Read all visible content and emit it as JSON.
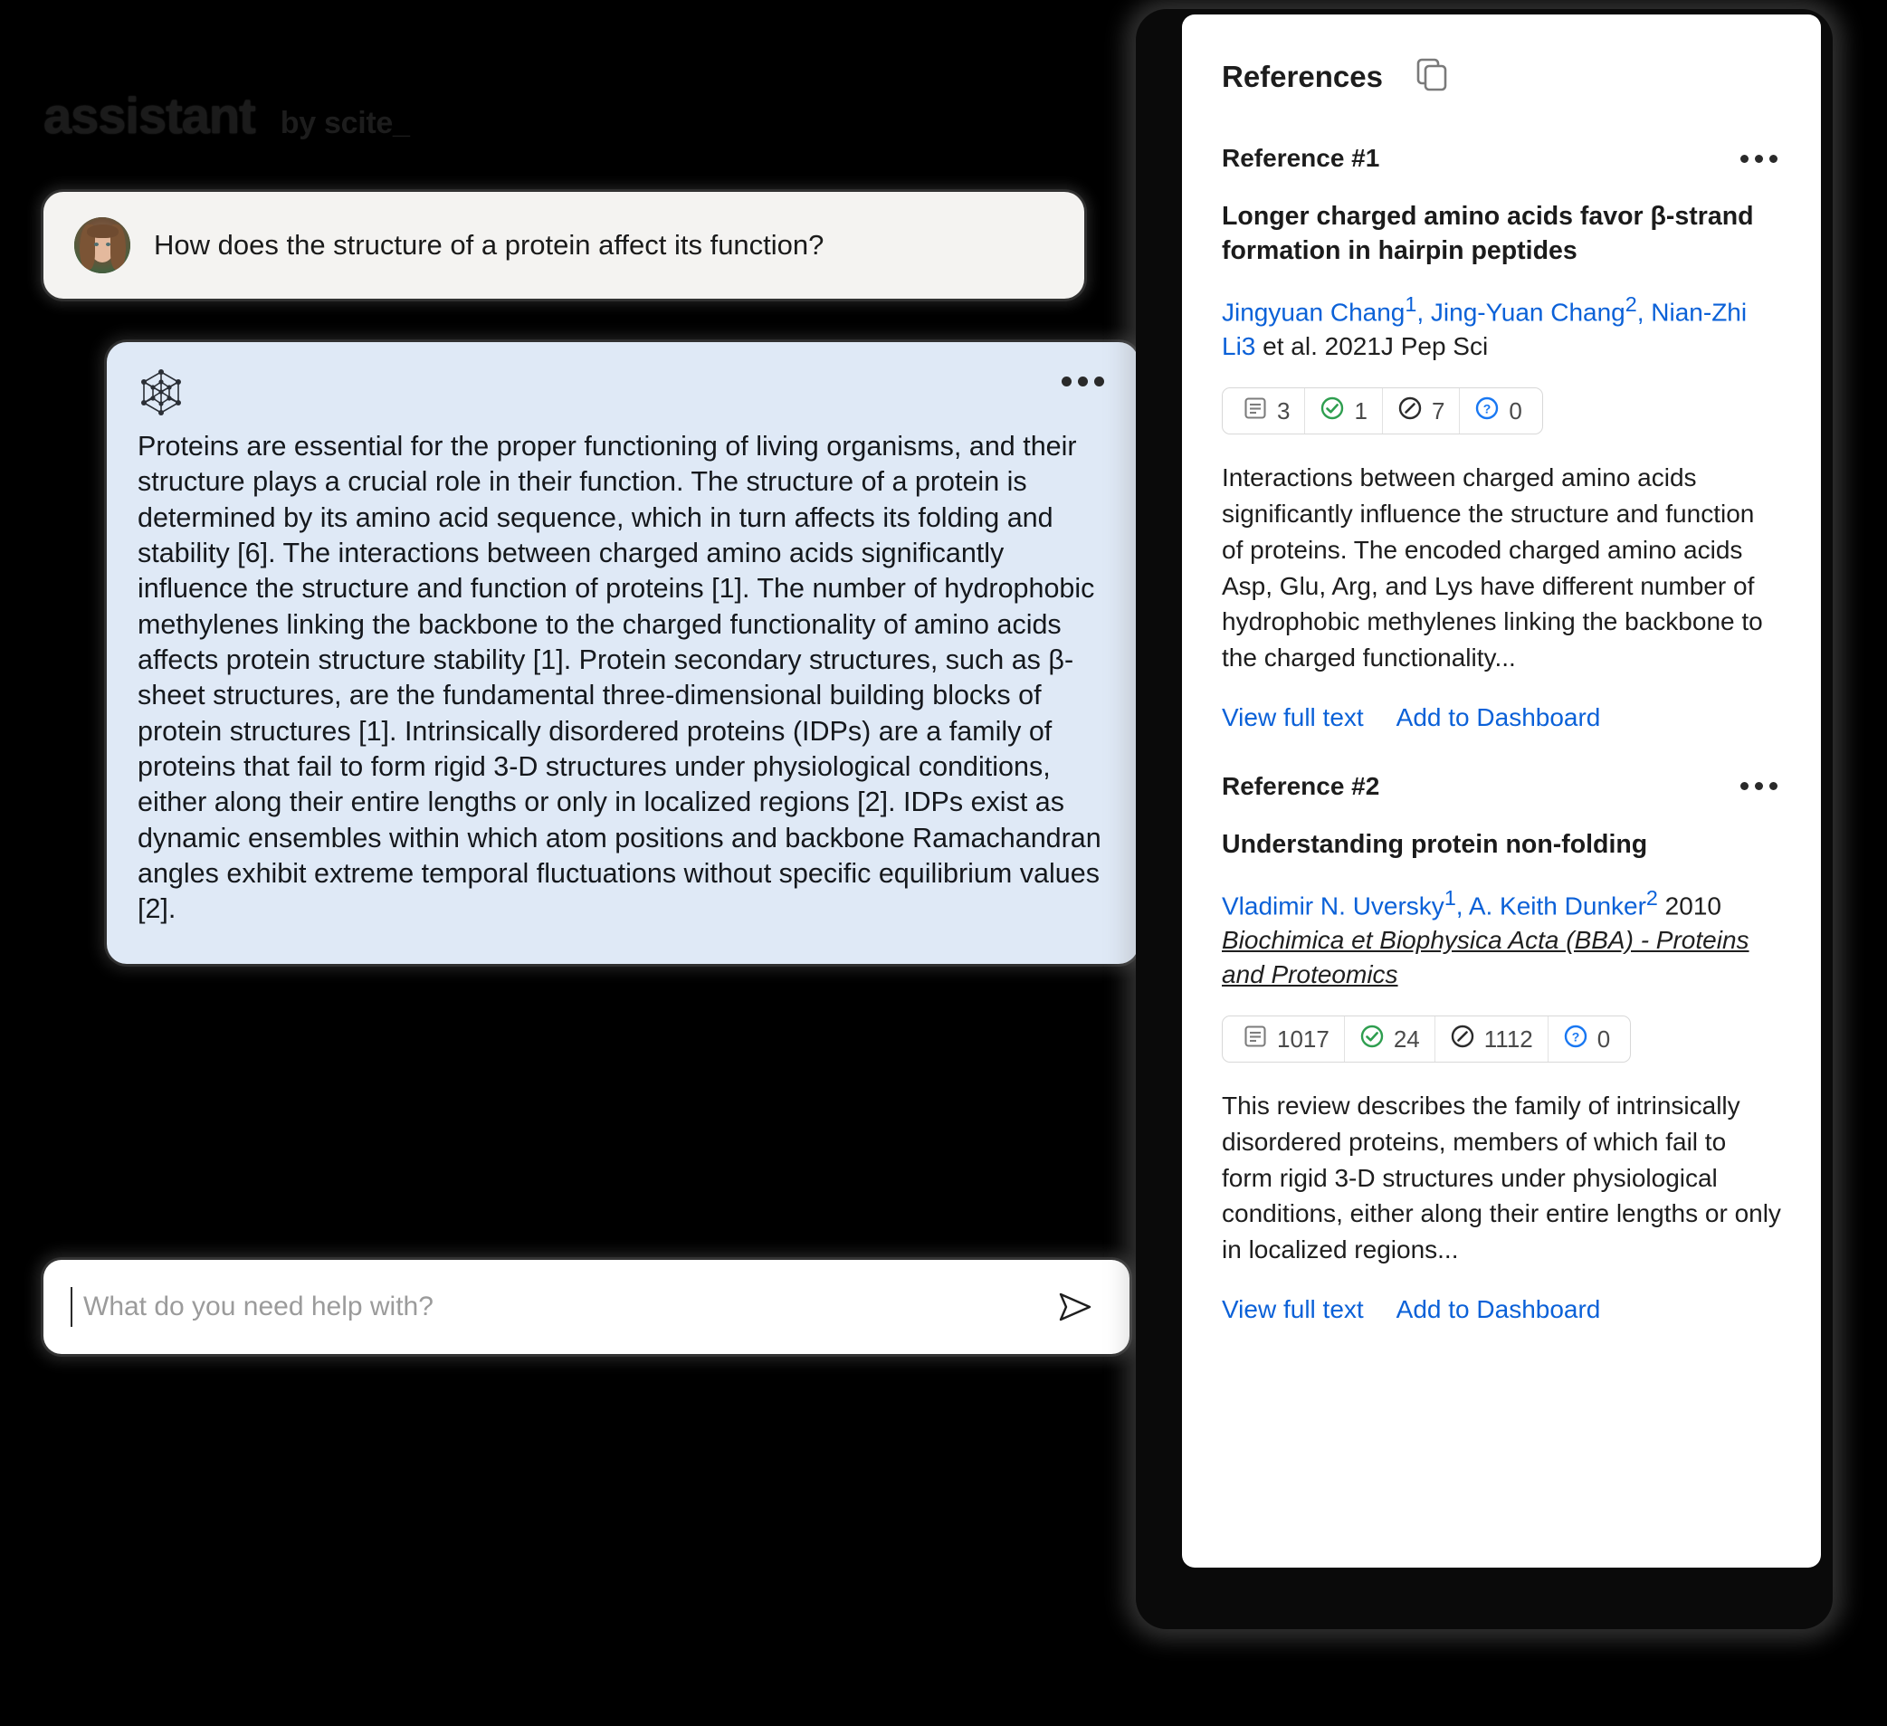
{
  "brand": {
    "name": "assistant",
    "by": "by scite_"
  },
  "chat": {
    "user_message": "How does the structure of a protein affect its function?",
    "assistant_message": "Proteins are essential for the proper functioning of living organisms, and their structure plays a crucial role in their function. The structure of a protein is determined by its amino acid sequence, which in turn affects its folding and stability [6]. The interactions between charged amino acids significantly influence the structure and function of proteins [1]. The number of hydrophobic methylenes linking the backbone to the charged functionality of amino acids affects protein structure stability [1]. Protein secondary structures, such as β-sheet structures, are the fundamental three-dimensional building blocks of protein structures [1]. Intrinsically disordered proteins (IDPs) are a family of proteins that fail to form rigid 3-D structures under physiological conditions, either along their entire lengths or only in localized regions [2]. IDPs exist as dynamic ensembles within which atom positions and backbone Ramachandran angles exhibit extreme temporal fluctuations without specific equilibrium values [2].",
    "assistant_menu_label": "•••"
  },
  "composer": {
    "placeholder": "What do you need help with?",
    "value": "",
    "send_label": "Send"
  },
  "references_panel": {
    "title": "References",
    "copy_icon": "copy-icon",
    "items": [
      {
        "number": "Reference #1",
        "menu_label": "•••",
        "title": "Longer charged amino acids favor β-strand formation in hairpin peptides",
        "authors": [
          {
            "text": "Jingyuan Chang",
            "sup": "1"
          },
          {
            "text": "Jing-Yuan Chang",
            "sup": "2"
          },
          {
            "text": "Nian-Zhi Li3",
            "sup": ""
          }
        ],
        "authors_tail": " et al. 2021J Pep Sci",
        "journal": "",
        "metrics": [
          {
            "icon": "citations-icon",
            "value": "3",
            "color": "#6b6b6b"
          },
          {
            "icon": "supporting-icon",
            "value": "1",
            "color": "#2e9e4f"
          },
          {
            "icon": "mentioning-icon",
            "value": "7",
            "color": "#2b2b2b"
          },
          {
            "icon": "contrasting-icon",
            "value": "0",
            "color": "#1877f2"
          }
        ],
        "abstract": "Interactions between charged amino acids significantly influence the structure and function of proteins. The encoded charged amino acids Asp, Glu, Arg, and Lys have different number of hydrophobic methylenes linking the backbone to the charged functionality...",
        "link_full_text": "View full text",
        "link_dashboard": "Add to Dashboard"
      },
      {
        "number": "Reference #2",
        "menu_label": "•••",
        "title": "Understanding protein non-folding",
        "authors": [
          {
            "text": "Vladimir N. Uversky",
            "sup": "1"
          },
          {
            "text": "A. Keith Dunker",
            "sup": "2"
          }
        ],
        "authors_tail": " 2010 ",
        "journal": "Biochimica et Biophysica Acta (BBA) - Proteins and Proteomics",
        "metrics": [
          {
            "icon": "citations-icon",
            "value": "1017",
            "color": "#6b6b6b"
          },
          {
            "icon": "supporting-icon",
            "value": "24",
            "color": "#2e9e4f"
          },
          {
            "icon": "mentioning-icon",
            "value": "1112",
            "color": "#2b2b2b"
          },
          {
            "icon": "contrasting-icon",
            "value": "0",
            "color": "#1877f2"
          }
        ],
        "abstract": "This review describes the family of intrinsically disordered proteins, members of which fail to form rigid 3-D structures under physiological conditions, either along their entire lengths or only in localized regions...",
        "link_full_text": "View full text",
        "link_dashboard": "Add to Dashboard"
      }
    ]
  },
  "colors": {
    "link": "#0b61d8",
    "assistant_bubble": "#dfe9f6",
    "user_bubble": "#f4f3f1",
    "supporting_green": "#2e9e4f",
    "contrasting_blue": "#1877f2"
  }
}
